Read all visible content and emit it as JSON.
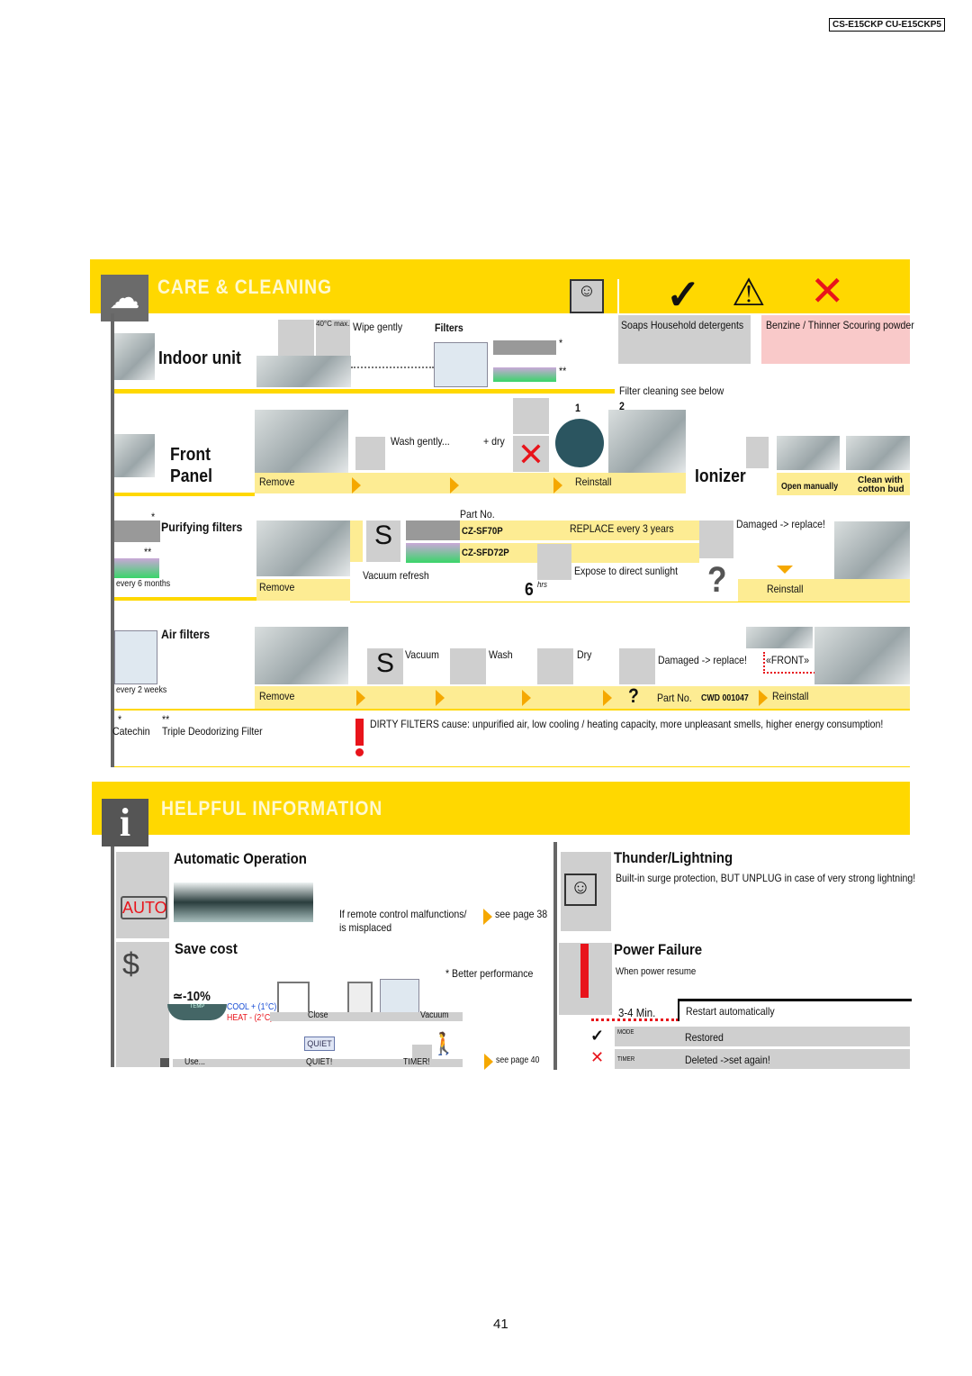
{
  "model": "CS-E15CKP CU-E15CKP5",
  "care": {
    "title": "CARE & CLEANING",
    "indoor_unit": "Indoor unit",
    "temp_badge": "40°C max.",
    "wipe": "Wipe gently",
    "filters": "Filters",
    "star1": "*",
    "star2": "**",
    "ok_label": "Soaps   Household detergents",
    "bad_label": "Benzine / Thinner    Scouring powder",
    "filter_see_below": "Filter cleaning see below",
    "front_panel_1": "Front",
    "front_panel_2": "Panel",
    "wash_gently": "Wash gently...",
    "dry": "+ dry",
    "remove": "Remove",
    "reinstall": "Reinstall",
    "step1": "1",
    "step2": "2",
    "ionizer": "Ionizer",
    "open_manually": "Open manually",
    "clean_cotton": "Clean with cotton bud",
    "purifying": "Purifying filters",
    "every6": "every 6 months",
    "vacuum_refresh": "Vacuum refresh",
    "part_no": "Part No.",
    "part1": "CZ-SF70P",
    "part2": "CZ-SFD72P",
    "replace3": "REPLACE every 3 years",
    "sunlight": "Expose to direct sunlight",
    "hours": "6",
    "hrs": "hrs",
    "damaged": "Damaged -> replace!",
    "question": "?",
    "air_filters": "Air filters",
    "every2": "every 2 weeks",
    "vacuum": "Vacuum",
    "wash": "Wash",
    "dry2": "Dry",
    "front": "«FRONT»",
    "part_no2": "Part No.",
    "part3": "CWD 001047",
    "catechin": "Catechin",
    "triple": "Triple Deodorizing Filter",
    "dirty": "DIRTY FILTERS cause: unpurified air, low cooling / heating capacity, more unpleasant smells, higher energy consumption!"
  },
  "helpful": {
    "title": "HELPFUL INFORMATION",
    "auto_op": "Automatic Operation",
    "auto": "AUTO",
    "remote": "If remote control malfunctions/",
    "misplaced": "is misplaced",
    "see38": "see page 38",
    "save_cost": "Save cost",
    "better": "* Better performance",
    "minus10": "≃-10%",
    "temp": "TEMP",
    "cool": "COOL + (1°C)",
    "heat": "HEAT - (2°C)",
    "close": "Close",
    "vacuum": "Vacuum",
    "use": "Use...",
    "quiet_btn": "QUIET",
    "quiet": "QUIET!",
    "timer": "TIMER!",
    "see40": "see page 40",
    "thunder": "Thunder/Lightning",
    "thunder_text": "Built-in surge protection, BUT UNPLUG in case of very strong lightning!",
    "power": "Power Failure",
    "power_text": "When power resume",
    "min": "3-4 Min.",
    "restart": "Restart automatically",
    "mode": "MODE",
    "restored": "Restored",
    "timer_lbl": "TIMER",
    "deleted": "Deleted  ->set again!"
  },
  "page_number": "41",
  "colors": {
    "yellow": "#ffd800",
    "light_yellow": "#fdec93",
    "orange": "#f5a800",
    "red": "#e8141b",
    "gray": "#cfcfcf",
    "pink": "#f9c9c9"
  }
}
